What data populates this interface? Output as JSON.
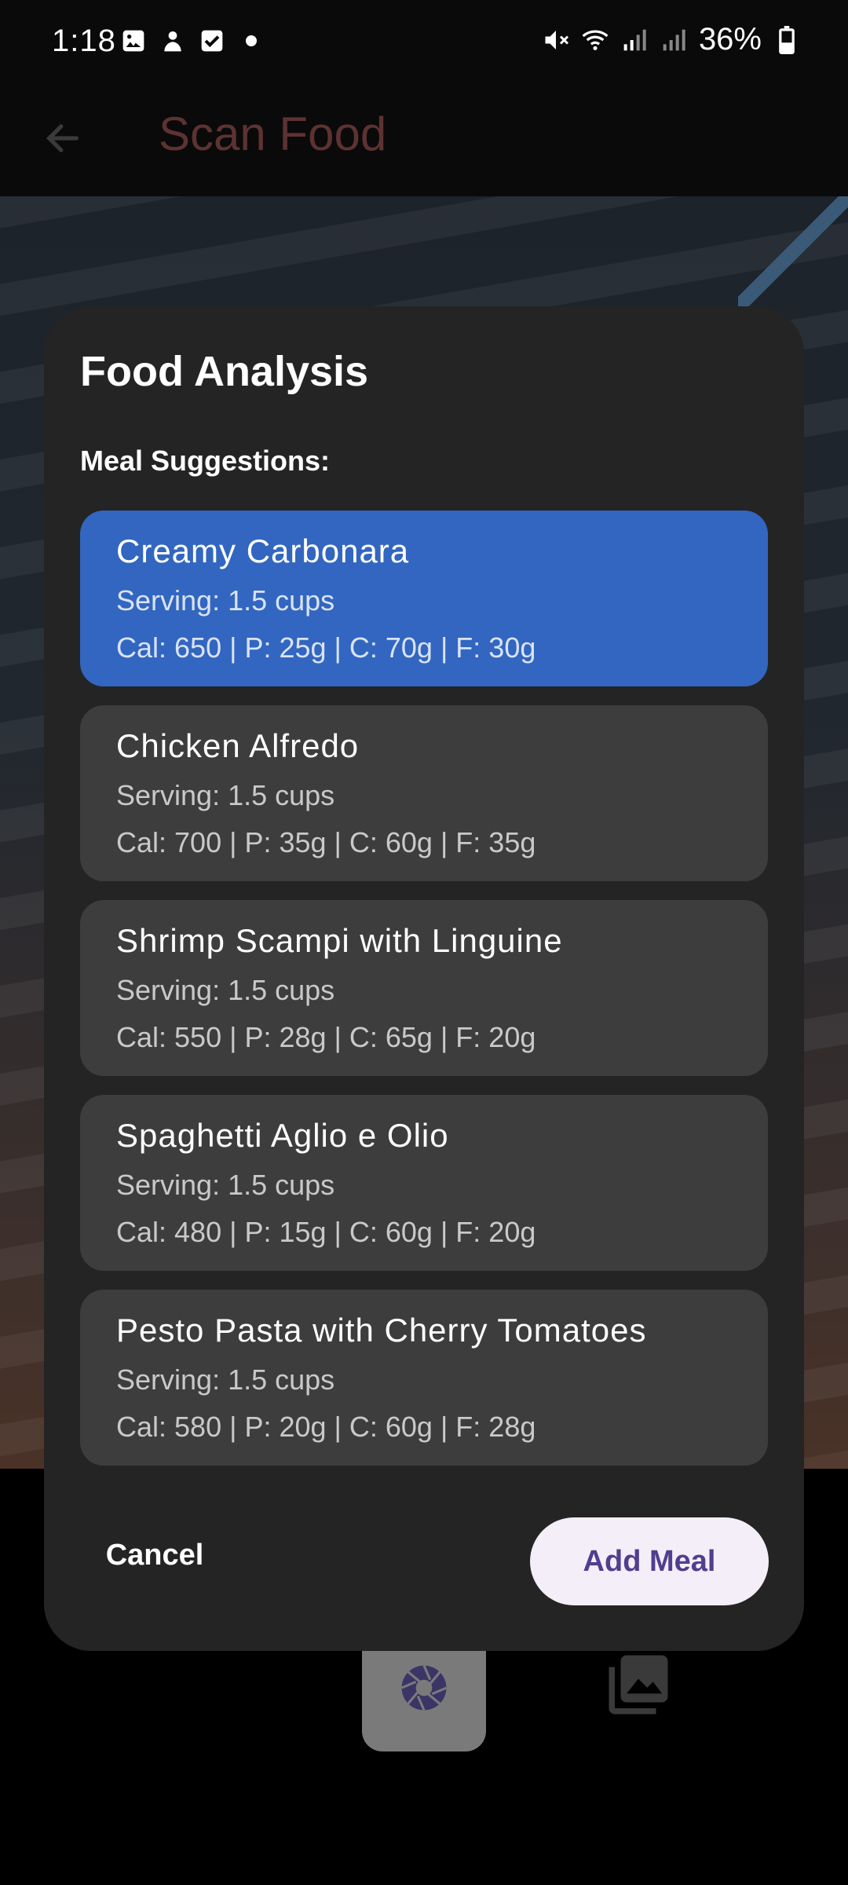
{
  "status_bar": {
    "time": "1:18",
    "battery": "36%"
  },
  "app_bar": {
    "title": "Scan Food"
  },
  "dialog": {
    "title": "Food Analysis",
    "section_label": "Meal Suggestions:",
    "meals": [
      {
        "name": "Creamy Carbonara",
        "serving": "Serving: 1.5 cups",
        "macros": "Cal: 650 | P: 25g | C: 70g | F: 30g",
        "selected": true
      },
      {
        "name": "Chicken Alfredo",
        "serving": "Serving: 1.5 cups",
        "macros": "Cal: 700 | P: 35g | C: 60g | F: 35g",
        "selected": false
      },
      {
        "name": "Shrimp Scampi with Linguine",
        "serving": "Serving: 1.5 cups",
        "macros": "Cal: 550 | P: 28g | C: 65g | F: 20g",
        "selected": false
      },
      {
        "name": "Spaghetti Aglio e Olio",
        "serving": "Serving: 1.5 cups",
        "macros": "Cal: 480 | P: 15g | C: 60g | F: 20g",
        "selected": false
      },
      {
        "name": "Pesto Pasta with Cherry Tomatoes",
        "serving": "Serving: 1.5 cups",
        "macros": "Cal: 580 | P: 20g | C: 60g | F: 28g",
        "selected": false
      }
    ],
    "cancel_label": "Cancel",
    "add_label": "Add Meal"
  },
  "colors": {
    "selected_card": "#3266c0",
    "card": "#3d3d3d",
    "dialog_bg": "#242424",
    "add_button_bg": "#f4eef8",
    "add_button_text": "#4f3f8f"
  },
  "icons": {
    "back": "arrow-back-icon",
    "shutter": "camera-shutter-icon",
    "gallery": "photo-library-icon"
  }
}
